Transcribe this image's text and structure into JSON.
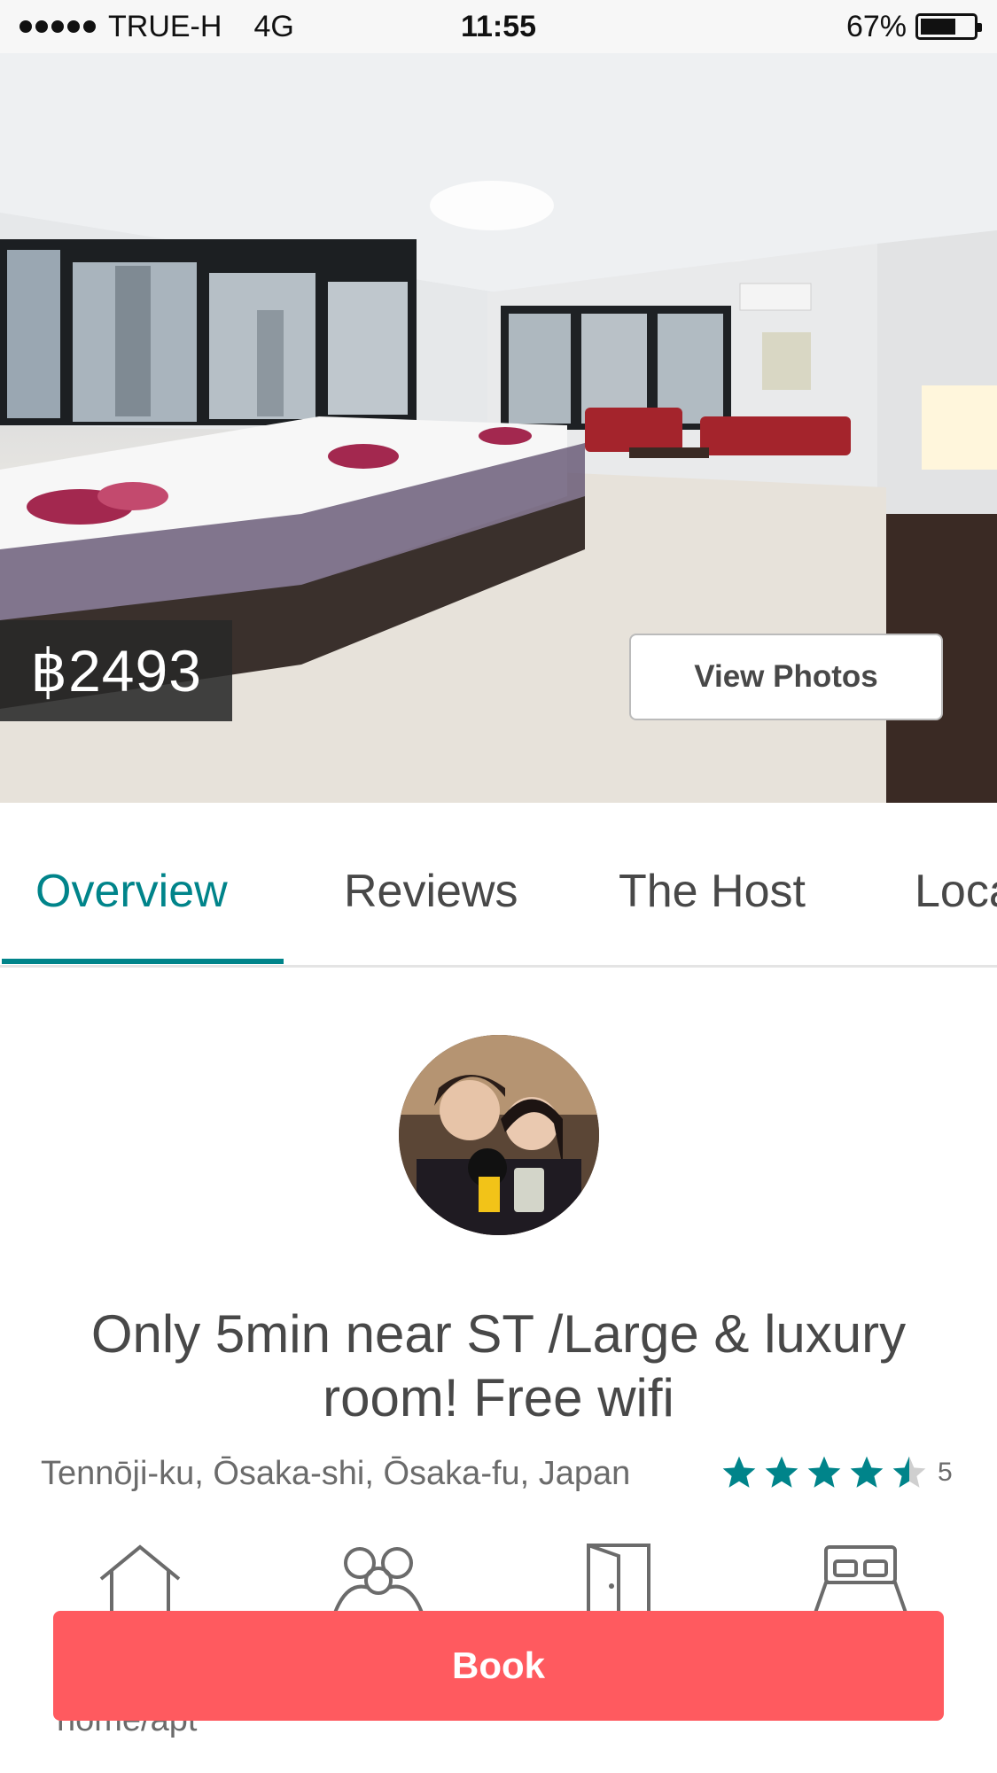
{
  "status_bar": {
    "carrier": "TRUE-H",
    "network": "4G",
    "time": "11:55",
    "battery_percent": "67%",
    "battery_level": 0.67
  },
  "listing": {
    "price": "฿2493",
    "view_photos_label": "View Photos",
    "title": "Only 5min near ST /Large & luxury room! Free wifi",
    "location": "Tennōji-ku, Ōsaka-shi, Ōsaka-fu, Japan",
    "rating_stars": 4.5,
    "review_count": "5",
    "room_type_label": "home/apt"
  },
  "tabs": [
    {
      "label": "Overview",
      "active": true
    },
    {
      "label": "Reviews",
      "active": false
    },
    {
      "label": "The Host",
      "active": false
    },
    {
      "label": "Location",
      "active": false
    }
  ],
  "amenity_icons": [
    "house-icon",
    "guests-icon",
    "door-icon",
    "bed-icon"
  ],
  "book": {
    "label": "Book"
  },
  "colors": {
    "accent": "#00848a",
    "book": "#ff5a5f",
    "star": "#00848a"
  }
}
